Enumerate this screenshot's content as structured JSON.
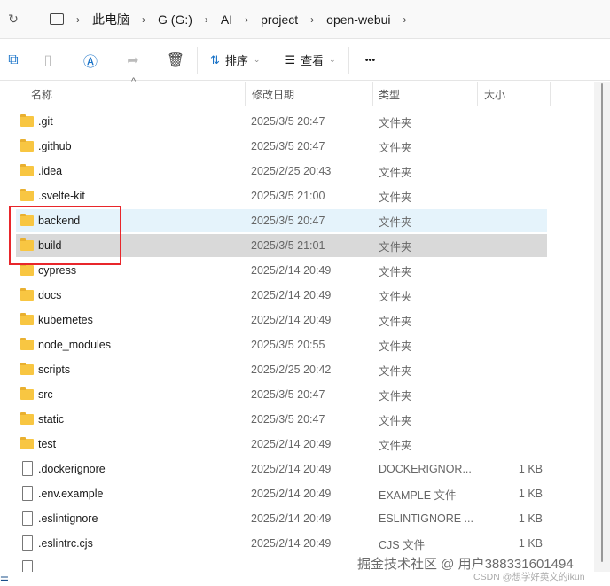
{
  "address": {
    "crumbs": [
      "此电脑",
      "G (G:)",
      "AI",
      "project",
      "open-webui"
    ]
  },
  "toolbar": {
    "sort_label": "排序",
    "view_label": "查看",
    "more_label": "•••"
  },
  "columns": {
    "name": "名称",
    "date": "修改日期",
    "type": "类型",
    "size": "大小"
  },
  "files": [
    {
      "name": ".git",
      "date": "2025/3/5 20:47",
      "type": "文件夹",
      "size": "",
      "kind": "folder"
    },
    {
      "name": ".github",
      "date": "2025/3/5 20:47",
      "type": "文件夹",
      "size": "",
      "kind": "folder"
    },
    {
      "name": ".idea",
      "date": "2025/2/25 20:43",
      "type": "文件夹",
      "size": "",
      "kind": "folder"
    },
    {
      "name": ".svelte-kit",
      "date": "2025/3/5 21:00",
      "type": "文件夹",
      "size": "",
      "kind": "folder"
    },
    {
      "name": "backend",
      "date": "2025/3/5 20:47",
      "type": "文件夹",
      "size": "",
      "kind": "folder",
      "state": "selected"
    },
    {
      "name": "build",
      "date": "2025/3/5 21:01",
      "type": "文件夹",
      "size": "",
      "kind": "folder",
      "state": "hover"
    },
    {
      "name": "cypress",
      "date": "2025/2/14 20:49",
      "type": "文件夹",
      "size": "",
      "kind": "folder"
    },
    {
      "name": "docs",
      "date": "2025/2/14 20:49",
      "type": "文件夹",
      "size": "",
      "kind": "folder"
    },
    {
      "name": "kubernetes",
      "date": "2025/2/14 20:49",
      "type": "文件夹",
      "size": "",
      "kind": "folder"
    },
    {
      "name": "node_modules",
      "date": "2025/3/5 20:55",
      "type": "文件夹",
      "size": "",
      "kind": "folder"
    },
    {
      "name": "scripts",
      "date": "2025/2/25 20:42",
      "type": "文件夹",
      "size": "",
      "kind": "folder"
    },
    {
      "name": "src",
      "date": "2025/3/5 20:47",
      "type": "文件夹",
      "size": "",
      "kind": "folder"
    },
    {
      "name": "static",
      "date": "2025/3/5 20:47",
      "type": "文件夹",
      "size": "",
      "kind": "folder"
    },
    {
      "name": "test",
      "date": "2025/2/14 20:49",
      "type": "文件夹",
      "size": "",
      "kind": "folder"
    },
    {
      "name": ".dockerignore",
      "date": "2025/2/14 20:49",
      "type": "DOCKERIGNOR...",
      "size": "1 KB",
      "kind": "file"
    },
    {
      "name": ".env.example",
      "date": "2025/2/14 20:49",
      "type": "EXAMPLE 文件",
      "size": "1 KB",
      "kind": "file"
    },
    {
      "name": ".eslintignore",
      "date": "2025/2/14 20:49",
      "type": "ESLINTIGNORE ...",
      "size": "1 KB",
      "kind": "file"
    },
    {
      "name": ".eslintrc.cjs",
      "date": "2025/2/14 20:49",
      "type": "CJS 文件",
      "size": "1 KB",
      "kind": "file"
    }
  ],
  "watermarks": {
    "juejin": "掘金技术社区 @ 用户388331601494",
    "csdn": "CSDN @想学好英文的ikun"
  }
}
